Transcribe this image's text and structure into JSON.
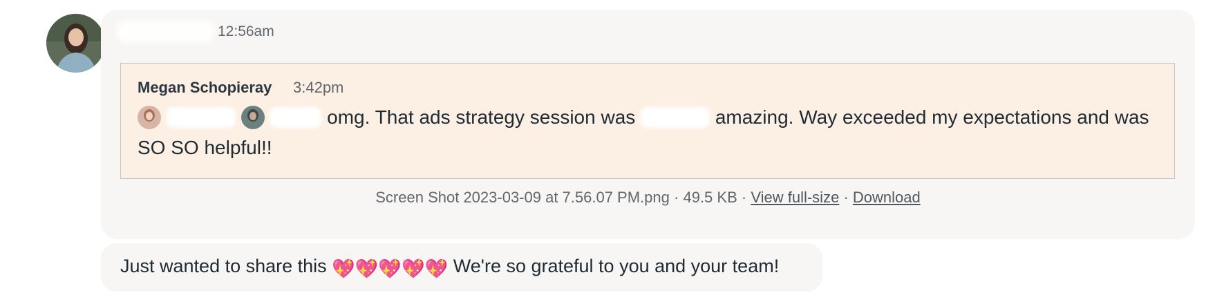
{
  "message": {
    "timestamp": "12:56am",
    "quote": {
      "author": "Megan Schopieray",
      "time": "3:42pm",
      "text_part1": "omg. That ads strategy session was",
      "text_part2": "amazing. Way exceeded my expectations and was SO SO helpful!!"
    },
    "attachment": {
      "filename": "Screen Shot 2023-03-09 at 7.56.07 PM.png",
      "size": "49.5 KB",
      "separator": "·",
      "view_label": "View full-size",
      "download_label": "Download"
    }
  },
  "reply": {
    "text_before": "Just wanted to share this",
    "emoji": "💖💖💖💖💖",
    "text_after": "We're so grateful to you and your team!"
  },
  "colors": {
    "bubble": "#f8f6f4",
    "quote_bg": "#fcf0e4",
    "heart": "#e8339a"
  },
  "icons": [
    "sparkling-heart-icon"
  ]
}
